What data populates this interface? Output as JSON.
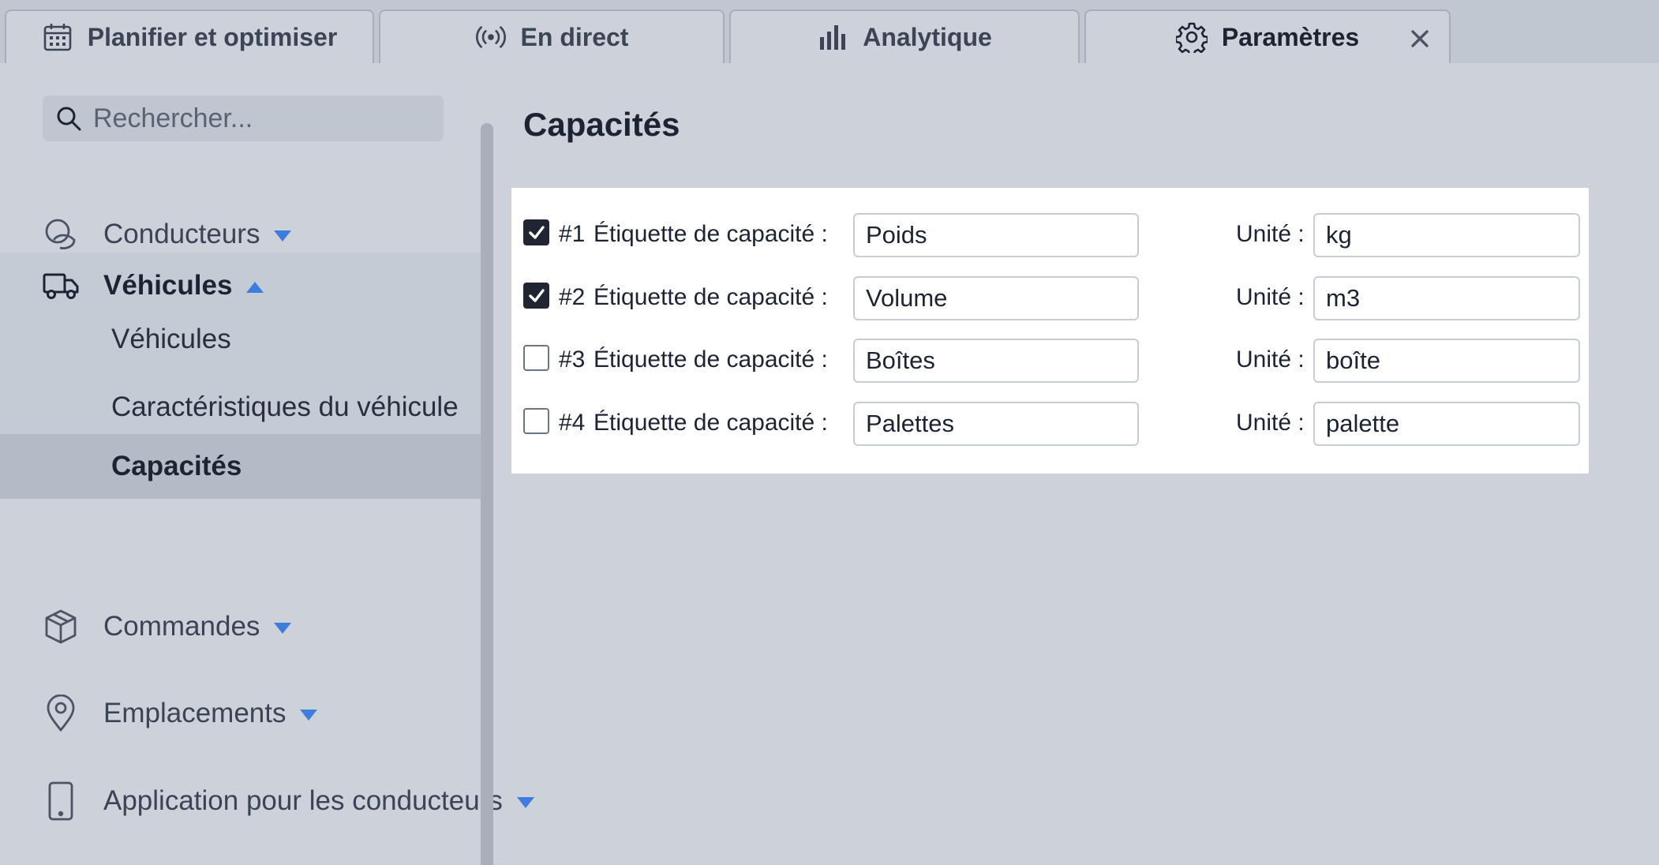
{
  "tabs": [
    {
      "label": "Planifier et optimiser",
      "icon": "calendar-icon"
    },
    {
      "label": "En direct",
      "icon": "broadcast-icon"
    },
    {
      "label": "Analytique",
      "icon": "bar-chart-icon"
    },
    {
      "label": "Paramètres",
      "icon": "gear-icon",
      "active": true
    }
  ],
  "search": {
    "placeholder": "Rechercher..."
  },
  "sidebar": {
    "conducteurs": "Conducteurs",
    "vehicules": "Véhicules",
    "vehicules_sub": [
      "Véhicules",
      "Caractéristiques du véhicule",
      "Capacités"
    ],
    "commandes": "Commandes",
    "emplacements": "Emplacements",
    "application": "Application pour les conducteurs"
  },
  "main": {
    "title": "Capacités",
    "rows": [
      {
        "num": "#1",
        "label": "Étiquette de capacité :",
        "value": "Poids",
        "unit_label": "Unité :",
        "unit": "kg",
        "checked": true
      },
      {
        "num": "#2",
        "label": "Étiquette de capacité :",
        "value": "Volume",
        "unit_label": "Unité :",
        "unit": "m3",
        "checked": true
      },
      {
        "num": "#3",
        "label": "Étiquette de capacité :",
        "value": "Boîtes",
        "unit_label": "Unité :",
        "unit": "boîte",
        "checked": false
      },
      {
        "num": "#4",
        "label": "Étiquette de capacité :",
        "value": "Palettes",
        "unit_label": "Unité :",
        "unit": "palette",
        "checked": false
      }
    ]
  },
  "colors": {
    "accent": "#3d7ddc",
    "background": "#cdd2da",
    "panel": "#ffffff",
    "active_item": "#b3bbc7"
  }
}
